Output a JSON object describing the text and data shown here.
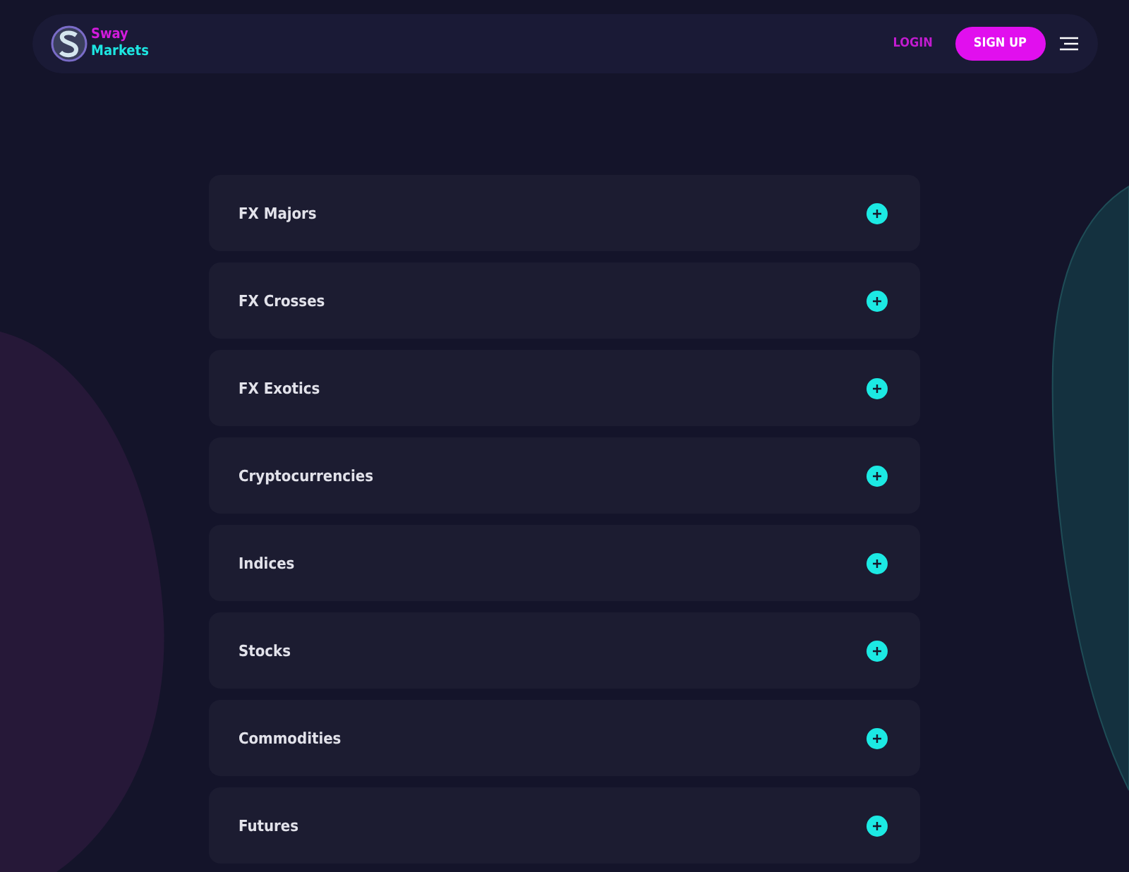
{
  "header": {
    "logo": {
      "line_1": "Sway",
      "line_2": "Markets"
    },
    "login": "LOGIN",
    "signup": "SIGN UP"
  },
  "accordion": [
    {
      "title": "FX Majors",
      "expanded": false
    },
    {
      "title": "FX Crosses",
      "expanded": false
    },
    {
      "title": "FX Exotics",
      "expanded": false
    },
    {
      "title": "Cryptocurrencies",
      "expanded": false
    },
    {
      "title": "Indices",
      "expanded": false
    },
    {
      "title": "Stocks",
      "expanded": false
    },
    {
      "title": "Commodities",
      "expanded": false
    },
    {
      "title": "Futures",
      "expanded": false
    }
  ]
}
